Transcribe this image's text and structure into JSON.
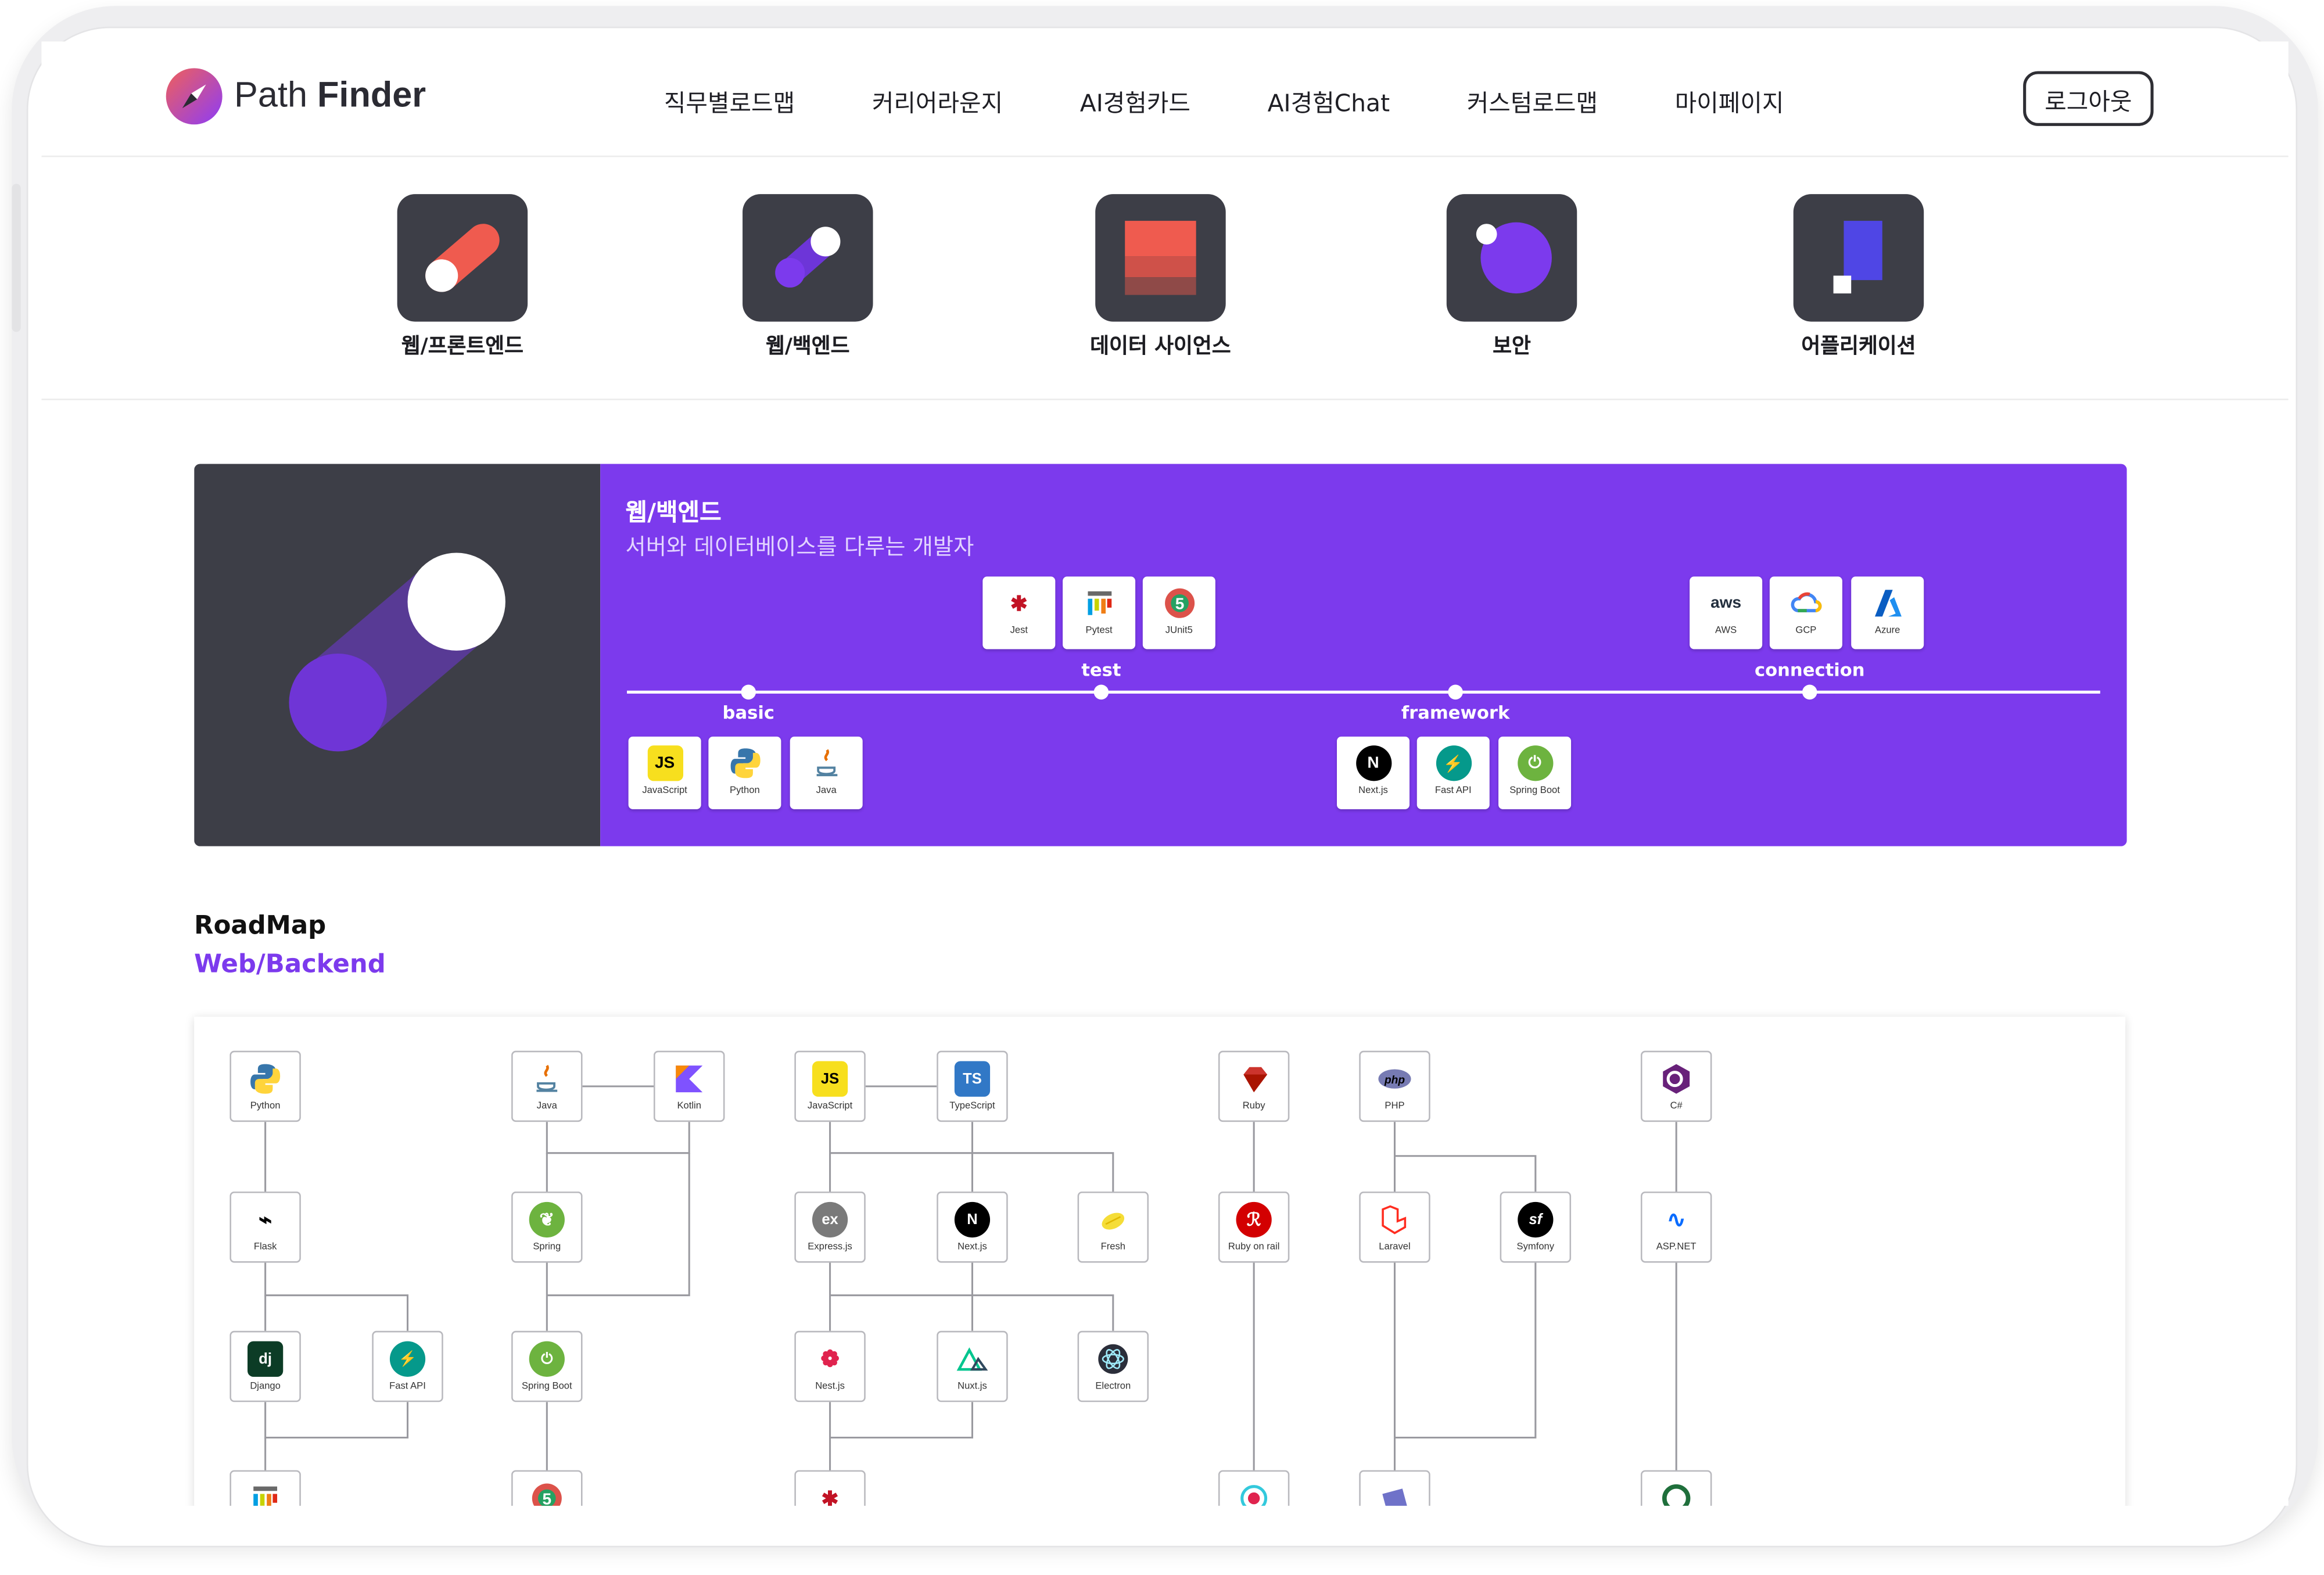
{
  "header": {
    "logo_text_light": "Path ",
    "logo_text_bold": "Finder",
    "nav": [
      "직무별로드맵",
      "커리어라운지",
      "AI경험카드",
      "AI경험Chat",
      "커스텀로드맵",
      "마이페이지"
    ],
    "logout_label": "로그아웃"
  },
  "categories": [
    {
      "label": "웹/프론트엔드",
      "icon": "frontend-toggle-icon"
    },
    {
      "label": "웹/백엔드",
      "icon": "backend-toggle-icon"
    },
    {
      "label": "데이터 사이언스",
      "icon": "data-stack-icon"
    },
    {
      "label": "보안",
      "icon": "security-orb-icon"
    },
    {
      "label": "어플리케이션",
      "icon": "application-block-icon"
    }
  ],
  "hero": {
    "title": "웹/백엔드",
    "subtitle": "서버와 데이터베이스를 다루는 개발자",
    "stages": [
      {
        "label": "basic",
        "techs": [
          "JavaScript",
          "Python",
          "Java"
        ]
      },
      {
        "label": "test",
        "techs": [
          "Jest",
          "Pytest",
          "JUnit5"
        ]
      },
      {
        "label": "framework",
        "techs": [
          "Next.js",
          "Fast API",
          "Spring Boot"
        ]
      },
      {
        "label": "connection",
        "techs": [
          "AWS",
          "GCP",
          "Azure"
        ]
      }
    ]
  },
  "roadmap": {
    "title": "RoadMap",
    "subtitle": "Web/Backend",
    "nodes": [
      "Python",
      "Flask",
      "Django",
      "Fast API",
      "Java",
      "Kotlin",
      "Spring",
      "Spring Boot",
      "JavaScript",
      "TypeScript",
      "Express.js",
      "Next.js",
      "Fresh",
      "Nest.js",
      "Nuxt.js",
      "Electron",
      "Ruby",
      "Ruby on rail",
      "PHP",
      "Laravel",
      "Symfony",
      "C#",
      "ASP.NET"
    ]
  },
  "colors": {
    "accent": "#7c3aed",
    "dark_panel": "#3d3e47",
    "coral": "#ef5b4f"
  }
}
